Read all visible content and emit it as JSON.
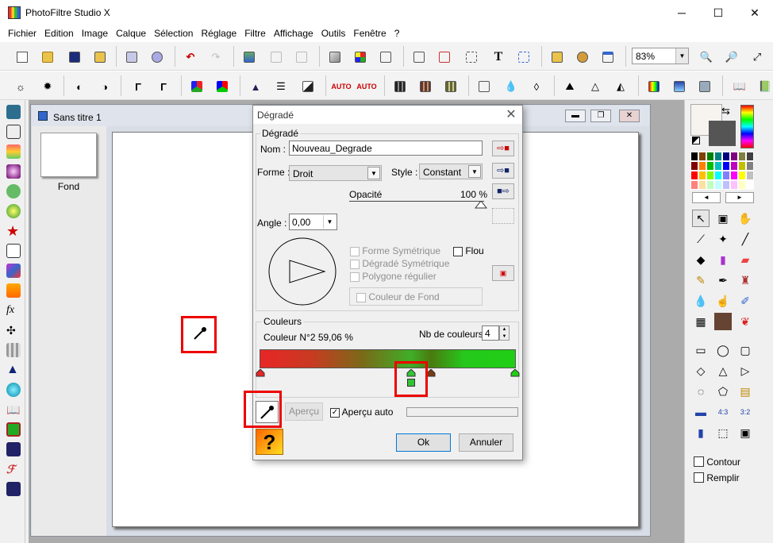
{
  "app": {
    "title": "PhotoFiltre Studio X",
    "minimize": "─",
    "maximize": "☐",
    "close": "✕"
  },
  "menu": [
    "Fichier",
    "Edition",
    "Image",
    "Calque",
    "Sélection",
    "Réglage",
    "Filtre",
    "Affichage",
    "Outils",
    "Fenêtre",
    "?"
  ],
  "toolbar": {
    "zoom": "83%"
  },
  "document": {
    "title": "Sans titre 1",
    "layer_label": "Fond",
    "btn_min": "▬",
    "btn_restore": "❐",
    "btn_close": "✕"
  },
  "dialog": {
    "title": "Dégradé",
    "group_degrade": "Dégradé",
    "nom_label": "Nom :",
    "nom_value": "Nouveau_Degrade",
    "forme_label": "Forme :",
    "forme_value": "Droit",
    "style_label": "Style :",
    "style_value": "Constant",
    "opacite_label": "Opacité",
    "opacite_value": "100 %",
    "opacite_fraction": 1.0,
    "angle_label": "Angle :",
    "angle_value": "0,00",
    "forme_sym": "Forme Symétrique",
    "flou": "Flou",
    "degrade_sym": "Dégradé Symétrique",
    "polygone": "Polygone régulier",
    "couleur_fond": "Couleur de Fond",
    "group_couleurs": "Couleurs",
    "couleur_info": "Couleur N°2 59,06 %",
    "nb_label": "Nb de couleurs :",
    "nb_value": "4",
    "apercu": "Aperçu",
    "apercu_auto": "Aperçu auto",
    "ok": "Ok",
    "annuler": "Annuler",
    "help_glyph": "?"
  },
  "gradient": {
    "stops": [
      {
        "position": 0,
        "color": "#e82626"
      },
      {
        "position": 59.06,
        "color": "#33c433"
      },
      {
        "position": 67,
        "color": "#7a3a12"
      },
      {
        "position": 100,
        "color": "#1fcf14"
      }
    ]
  },
  "rightpanel": {
    "contour": "Contour",
    "remplir": "Remplir",
    "prev": "◄",
    "next": "►"
  },
  "colors": {
    "accent": "#0078d7",
    "highlight": "#e00000",
    "foreground": "#f7f3ee",
    "background": "#555555"
  }
}
